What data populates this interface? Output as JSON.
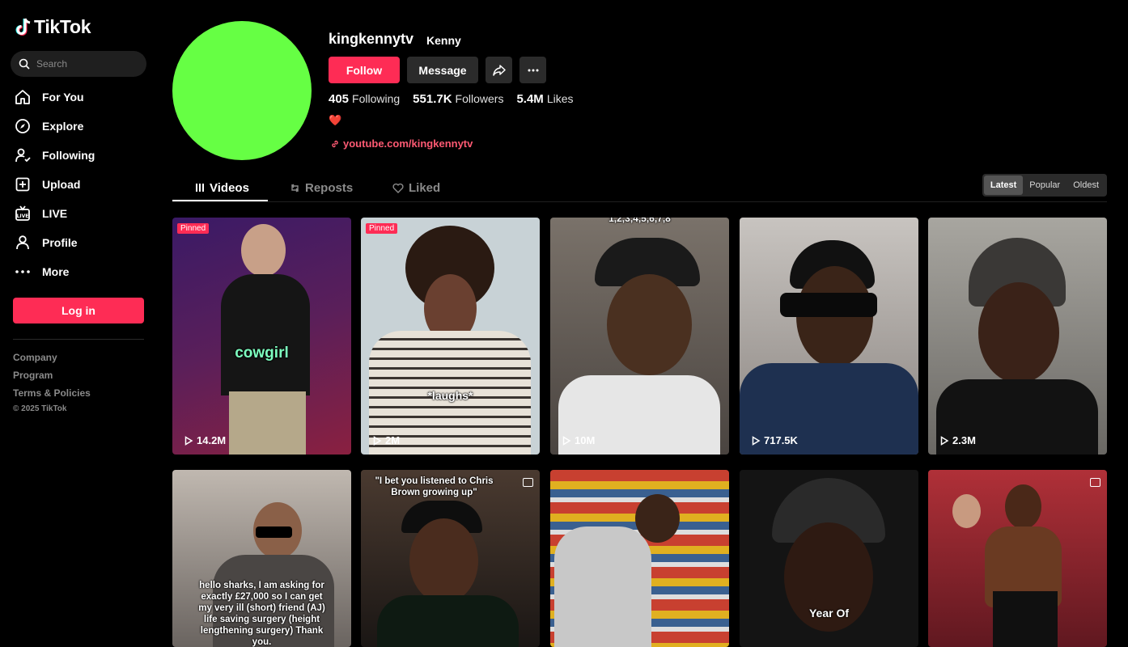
{
  "sidebar": {
    "logo": "TikTok",
    "search_placeholder": "Search",
    "nav": [
      {
        "label": "For You",
        "icon": "home-icon"
      },
      {
        "label": "Explore",
        "icon": "compass-icon"
      },
      {
        "label": "Following",
        "icon": "following-icon"
      },
      {
        "label": "Upload",
        "icon": "upload-icon"
      },
      {
        "label": "LIVE",
        "icon": "live-icon"
      },
      {
        "label": "Profile",
        "icon": "profile-icon"
      },
      {
        "label": "More",
        "icon": "more-dots-icon"
      }
    ],
    "login_label": "Log in",
    "footer": {
      "company": "Company",
      "program": "Program",
      "terms": "Terms & Policies",
      "copyright": "© 2025 TikTok"
    }
  },
  "profile": {
    "username": "kingkennytv",
    "nickname": "Kenny",
    "avatar_color": "#66ff44",
    "follow_label": "Follow",
    "message_label": "Message",
    "stats": {
      "following_count": "405",
      "following_label": "Following",
      "followers_count": "551.7K",
      "followers_label": "Followers",
      "likes_count": "5.4M",
      "likes_label": "Likes"
    },
    "bio": "❤️",
    "link": "youtube.com/kingkennytv"
  },
  "tabs": {
    "videos": "Videos",
    "reposts": "Reposts",
    "liked": "Liked",
    "sort": {
      "latest": "Latest",
      "popular": "Popular",
      "oldest": "Oldest",
      "selected": "Latest"
    }
  },
  "videos": [
    {
      "views": "14.2M",
      "pinned": "Pinned",
      "caption": "cowgirl",
      "bg": "#5a1f5a"
    },
    {
      "views": "2M",
      "pinned": "Pinned",
      "caption": "*laughs*",
      "bg": "#c8d2d6"
    },
    {
      "views": "10M",
      "caption": "1,2,3,4,5,6,7,8",
      "bg": "#6e6660"
    },
    {
      "views": "717.5K",
      "bg": "#a8a29c"
    },
    {
      "views": "2.3M",
      "bg": "#8c8a84"
    },
    {
      "caption": "hello sharks, I am asking for exactly £27,000 so I can get my very ill (short) friend (AJ) life saving surgery (height lengthening surgery) Thank you.",
      "bg": "#9a9288"
    },
    {
      "caption": "\"I bet you listened to Chris Brown growing up\"",
      "bg": "#2a2320"
    },
    {
      "bg": "#b0a898"
    },
    {
      "caption": "Year Of",
      "bg": "#141414"
    },
    {
      "bg": "#8a2a30"
    }
  ],
  "colors": {
    "accent": "#fe2c55",
    "background": "#000000",
    "button_bg": "#2b2b2b"
  }
}
